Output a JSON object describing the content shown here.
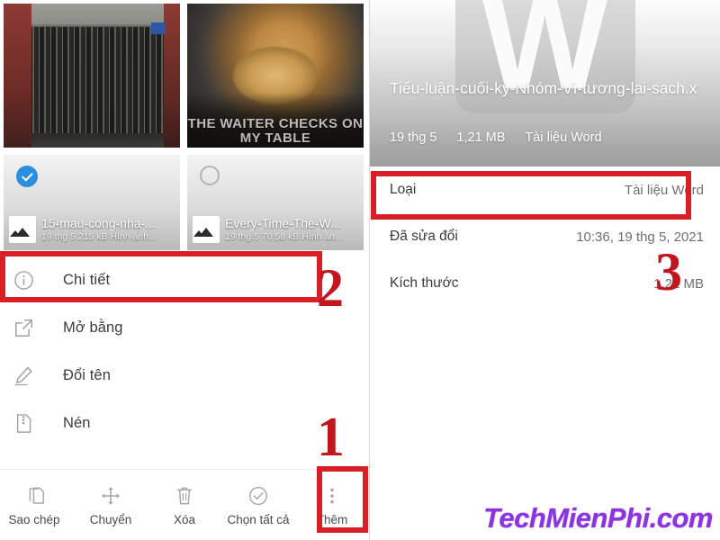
{
  "left": {
    "thumbnails": [
      {
        "name": "15-mau-cong-nha-...",
        "meta": "19 thg 5  215 kB  Hình ảnh...",
        "icon": "image-file-icon",
        "selected": true,
        "photo": "gate-photo"
      },
      {
        "name": "Every-Time-The-W...",
        "meta": "19 thg 5  70,58 kB  Hình ản...",
        "icon": "image-file-icon",
        "selected": false,
        "photo": "squirrel-meme-photo",
        "caption_line1": "THE WAITER CHECKS ON",
        "caption_line2": "MY TABLE"
      }
    ],
    "menu_items": [
      {
        "label": "Chi tiết",
        "icon": "info-circle-icon"
      },
      {
        "label": "Mở bằng",
        "icon": "open-in-new-icon"
      },
      {
        "label": "Đổi tên",
        "icon": "pencil-icon"
      },
      {
        "label": "Nén",
        "icon": "compress-file-icon"
      }
    ],
    "toolbar": [
      {
        "label": "Sao chép",
        "icon": "copy-icon"
      },
      {
        "label": "Chuyển",
        "icon": "move-icon"
      },
      {
        "label": "Xóa",
        "icon": "trash-icon"
      },
      {
        "label": "Chọn tất cả",
        "icon": "check-circle-icon"
      },
      {
        "label": "Thêm",
        "icon": "more-vertical-icon"
      }
    ]
  },
  "right": {
    "file_icon_letter": "W",
    "title": "Tiếu-luận-cuối-kỳ-Nhóm-Vì-tương-lai-sạch.x",
    "meta": {
      "date": "19 thg 5",
      "size": "1,21 MB",
      "type": "Tài liệu Word"
    },
    "details": [
      {
        "key": "Loại",
        "value": "Tài liệu Word"
      },
      {
        "key": "Đã sửa đổi",
        "value": "10:36, 19 thg 5, 2021"
      },
      {
        "key": "Kích thước",
        "value": "1,21 MB"
      }
    ]
  },
  "annotations": {
    "step1": "1",
    "step2": "2",
    "step3": "3",
    "highlight_color": "#d81f26",
    "number_color": "#c0161d"
  },
  "watermark": {
    "text": "TechMienPhi.com",
    "color": "#8b34e0"
  }
}
